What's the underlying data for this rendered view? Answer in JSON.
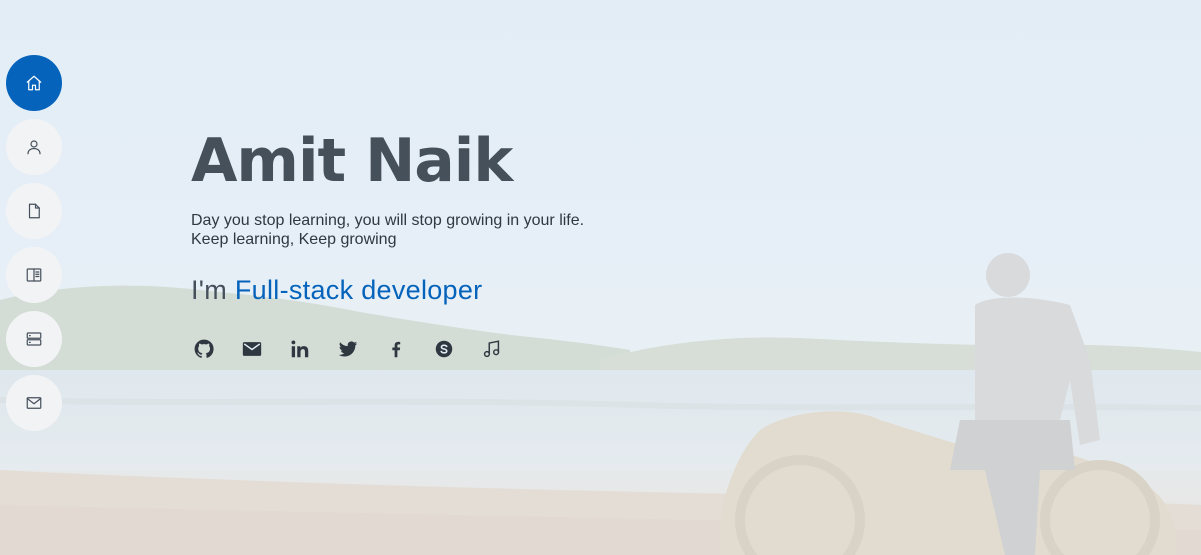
{
  "hero": {
    "name": "Amit Naik",
    "tagline_line1": "Day you stop learning, you will stop growing in your life.",
    "tagline_line2": "Keep learning, Keep growing",
    "typed_prefix": "I'm",
    "typed_role": "Full-stack developer"
  },
  "nav": {
    "items": [
      {
        "icon": "home-icon",
        "active": true
      },
      {
        "icon": "person-icon",
        "active": false
      },
      {
        "icon": "file-icon",
        "active": false
      },
      {
        "icon": "book-icon",
        "active": false
      },
      {
        "icon": "server-icon",
        "active": false
      },
      {
        "icon": "envelope-icon",
        "active": false
      }
    ]
  },
  "social": [
    "github-icon",
    "email-icon",
    "linkedin-icon",
    "twitter-icon",
    "facebook-icon",
    "skype-icon",
    "music-icon"
  ],
  "colors": {
    "accent": "#0563bb",
    "text": "#45505b",
    "nav_bg": "#f2f3f5"
  }
}
